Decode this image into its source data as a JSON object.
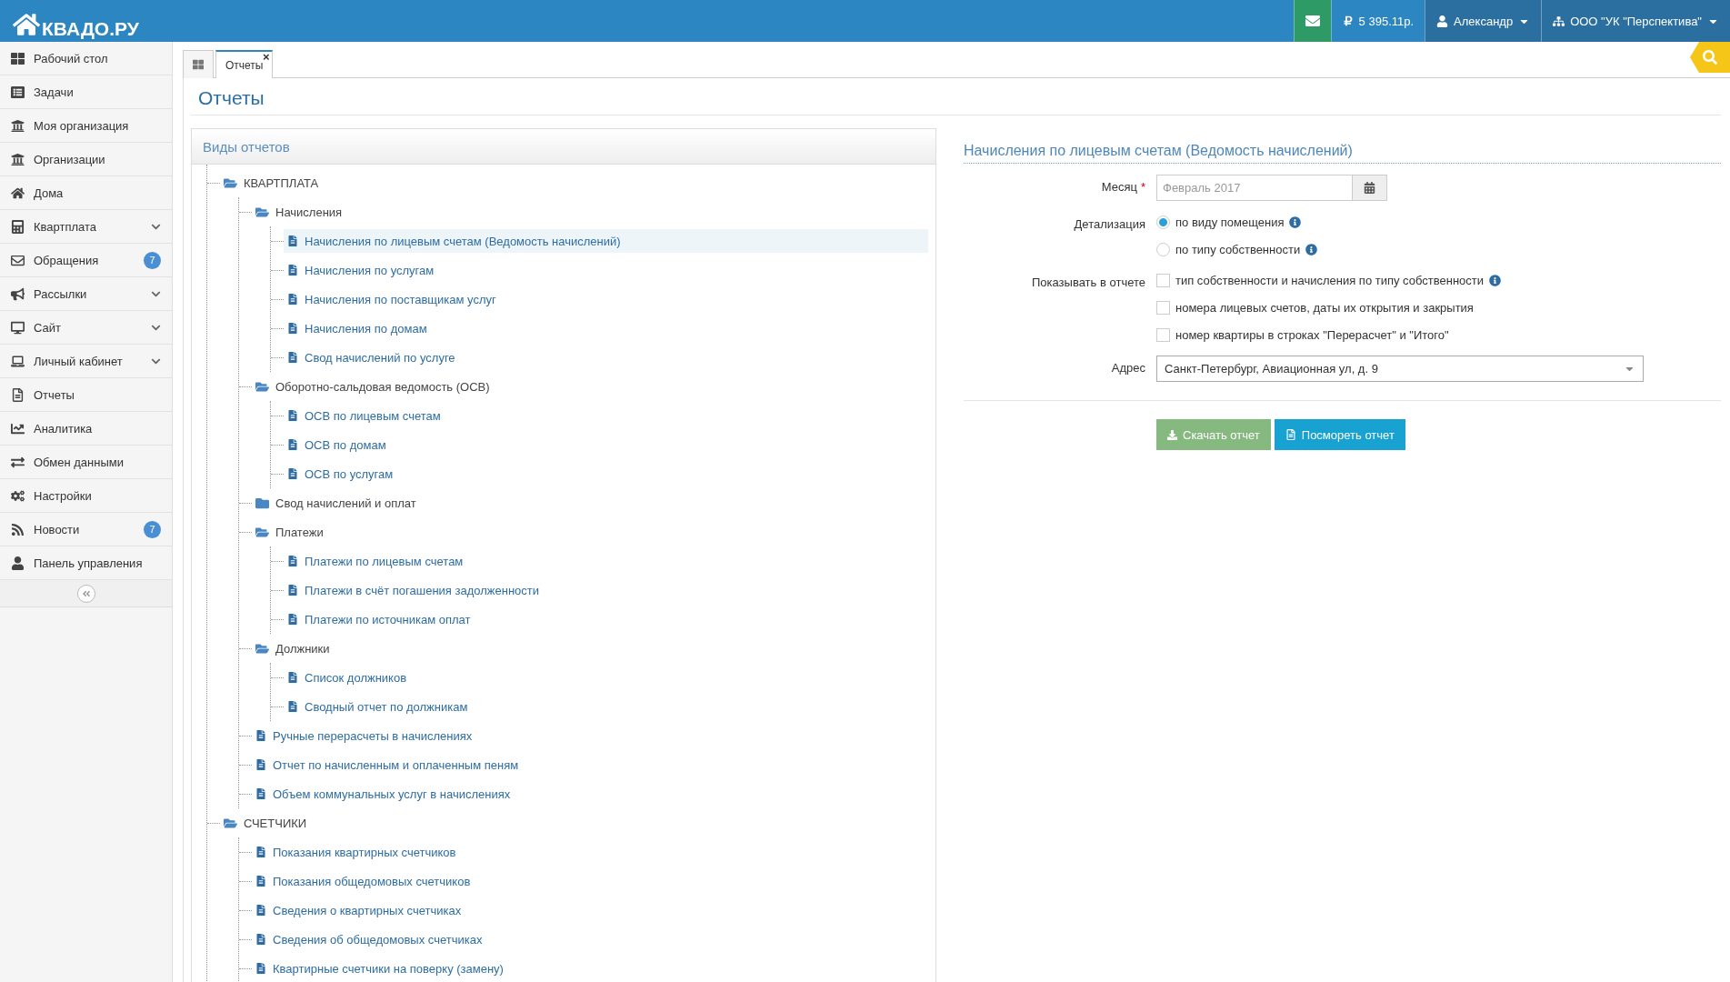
{
  "topbar": {
    "logo": "КВАДО.РУ",
    "balance": "5 395.11р.",
    "user": "Александр",
    "organization": "ООО \"УК \"Перспектива\""
  },
  "sidebar": {
    "items": [
      {
        "label": "Рабочий стол",
        "expandable": false
      },
      {
        "label": "Задачи",
        "expandable": false
      },
      {
        "label": "Моя организация",
        "expandable": false
      },
      {
        "label": "Организации",
        "expandable": false
      },
      {
        "label": "Дома",
        "expandable": false
      },
      {
        "label": "Квартплата",
        "expandable": true
      },
      {
        "label": "Обращения",
        "expandable": false,
        "badge": "7"
      },
      {
        "label": "Рассылки",
        "expandable": true
      },
      {
        "label": "Сайт",
        "expandable": true
      },
      {
        "label": "Личный кабинет",
        "expandable": true
      },
      {
        "label": "Отчеты",
        "expandable": false
      },
      {
        "label": "Аналитика",
        "expandable": false
      },
      {
        "label": "Обмен данными",
        "expandable": false
      },
      {
        "label": "Настройки",
        "expandable": false
      },
      {
        "label": "Новости",
        "expandable": false,
        "badge": "7"
      },
      {
        "label": "Панель управления",
        "expandable": false
      }
    ]
  },
  "tabs": [
    {
      "kind": "home",
      "selected": false
    },
    {
      "kind": "page",
      "label": "Отчеты",
      "close": "×",
      "selected": true
    }
  ],
  "page_title": "Отчеты",
  "report_types": {
    "title": "Виды отчетов",
    "tree": [
      {
        "kind": "folder",
        "label": "КВАРТПЛАТА",
        "expanded": true,
        "children": [
          {
            "kind": "folder",
            "label": "Начисления",
            "expanded": true,
            "children": [
              {
                "kind": "report",
                "label": "Начисления по лицевым счетам (Ведомость начислений)",
                "selected": true
              },
              {
                "kind": "report",
                "label": "Начисления по услугам",
                "selected": false
              },
              {
                "kind": "report",
                "label": "Начисления по поставщикам услуг",
                "selected": false
              },
              {
                "kind": "report",
                "label": "Начисления по домам",
                "selected": false
              },
              {
                "kind": "report",
                "label": "Свод начислений по услуге",
                "selected": false
              }
            ]
          },
          {
            "kind": "folder",
            "label": "Оборотно-сальдовая ведомость (ОСВ)",
            "expanded": true,
            "children": [
              {
                "kind": "report",
                "label": "ОСВ по лицевым счетам",
                "selected": false
              },
              {
                "kind": "report",
                "label": "ОСВ по домам",
                "selected": false
              },
              {
                "kind": "report",
                "label": "ОСВ по услугам",
                "selected": false
              }
            ]
          },
          {
            "kind": "folder",
            "label": "Свод начислений и оплат",
            "expanded": false
          },
          {
            "kind": "folder",
            "label": "Платежи",
            "expanded": true,
            "children": [
              {
                "kind": "report",
                "label": "Платежи по лицевым счетам",
                "selected": false
              },
              {
                "kind": "report",
                "label": "Платежи в счёт погашения задолженности",
                "selected": false
              },
              {
                "kind": "report",
                "label": "Платежи по источникам оплат",
                "selected": false
              }
            ]
          },
          {
            "kind": "folder",
            "label": "Должники",
            "expanded": true,
            "children": [
              {
                "kind": "report",
                "label": "Список должников",
                "selected": false
              },
              {
                "kind": "report",
                "label": "Сводный отчет по должникам",
                "selected": false
              }
            ]
          },
          {
            "kind": "report",
            "label": "Ручные перерасчеты в начислениях",
            "selected": false
          },
          {
            "kind": "report",
            "label": "Отчет по начисленным и оплаченным пеням",
            "selected": false
          },
          {
            "kind": "report",
            "label": "Объем коммунальных услуг в начислениях",
            "selected": false
          }
        ]
      },
      {
        "kind": "folder",
        "label": "СЧЕТЧИКИ",
        "expanded": true,
        "children": [
          {
            "kind": "report",
            "label": "Показания квартирных счетчиков",
            "selected": false
          },
          {
            "kind": "report",
            "label": "Показания общедомовых счетчиков",
            "selected": false
          },
          {
            "kind": "report",
            "label": "Сведения о квартирных счетчиках",
            "selected": false
          },
          {
            "kind": "report",
            "label": "Сведения об общедомовых счетчиках",
            "selected": false
          },
          {
            "kind": "report",
            "label": "Квартирные счетчики на поверку (замену)",
            "selected": false
          }
        ]
      }
    ]
  },
  "report_form": {
    "title": "Начисления по лицевым счетам (Ведомость начислений)",
    "month": {
      "label": "Месяц",
      "required": "*",
      "placeholder": "Февраль 2017"
    },
    "detail": {
      "label": "Детализация",
      "options": [
        {
          "label": "по виду помещения",
          "selected": true,
          "info": true
        },
        {
          "label": "по типу собственности",
          "selected": false,
          "info": true
        }
      ]
    },
    "show": {
      "label": "Показывать в отчете",
      "options": [
        {
          "label": "тип собственности и начисления по типу собственности",
          "checked": false,
          "info": true
        },
        {
          "label": "номера лицевых счетов, даты их открытия и закрытия",
          "checked": false,
          "info": false
        },
        {
          "label": "номер квартиры в строках \"Перерасчет\" и \"Итого\"",
          "checked": false,
          "info": false
        }
      ]
    },
    "address": {
      "label": "Адрес",
      "value": "Санкт-Петербург, Авиационная ул, д. 9"
    },
    "buttons": [
      {
        "kind": "download",
        "label": "Скачать отчет"
      },
      {
        "kind": "view",
        "label": "Посмореть отчет"
      }
    ]
  }
}
